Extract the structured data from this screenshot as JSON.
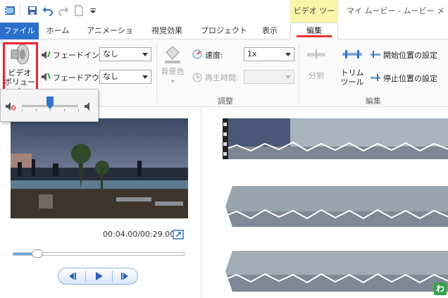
{
  "title_bar": {
    "context_tab_label": "ビデオ ツール",
    "app_title": "マイ ムービー - ムービー メーカー"
  },
  "tabs": {
    "file": "ファイル",
    "home": "ホーム",
    "animation": "アニメーション",
    "visual_effects": "視覚効果",
    "project": "プロジェクト",
    "view": "表示",
    "edit": "編集"
  },
  "ribbon": {
    "video_volume_label_line1": "ビデオ",
    "video_volume_label_line2": "ボリューム",
    "fade_in_label": "フェードイン:",
    "fade_in_value": "なし",
    "fade_out_label": "フェードアウト:",
    "fade_out_value": "なし",
    "background_color_label": "背景色",
    "speed_label": "速度:",
    "speed_value": "1x",
    "duration_label": "再生時間:",
    "duration_value": "",
    "adjust_group_label": "調整",
    "split_label": "分割",
    "trim_label_line1": "トリム",
    "trim_label_line2": "ツール",
    "set_start_label": "開始位置の設定",
    "set_end_label": "停止位置の設定",
    "edit_group_label": "編集"
  },
  "volume_popup": {
    "level_fraction": 0.5
  },
  "preview": {
    "timecode": "00:04.00/00:29.00",
    "seek_fraction": 0.14
  },
  "storyboard": {
    "badge_text": "わ"
  },
  "colors": {
    "file_tab": "#2a6fc9",
    "context_tab": "#fbf5a9",
    "highlight_red": "#e23333",
    "accent_blue": "#2f74c8"
  }
}
